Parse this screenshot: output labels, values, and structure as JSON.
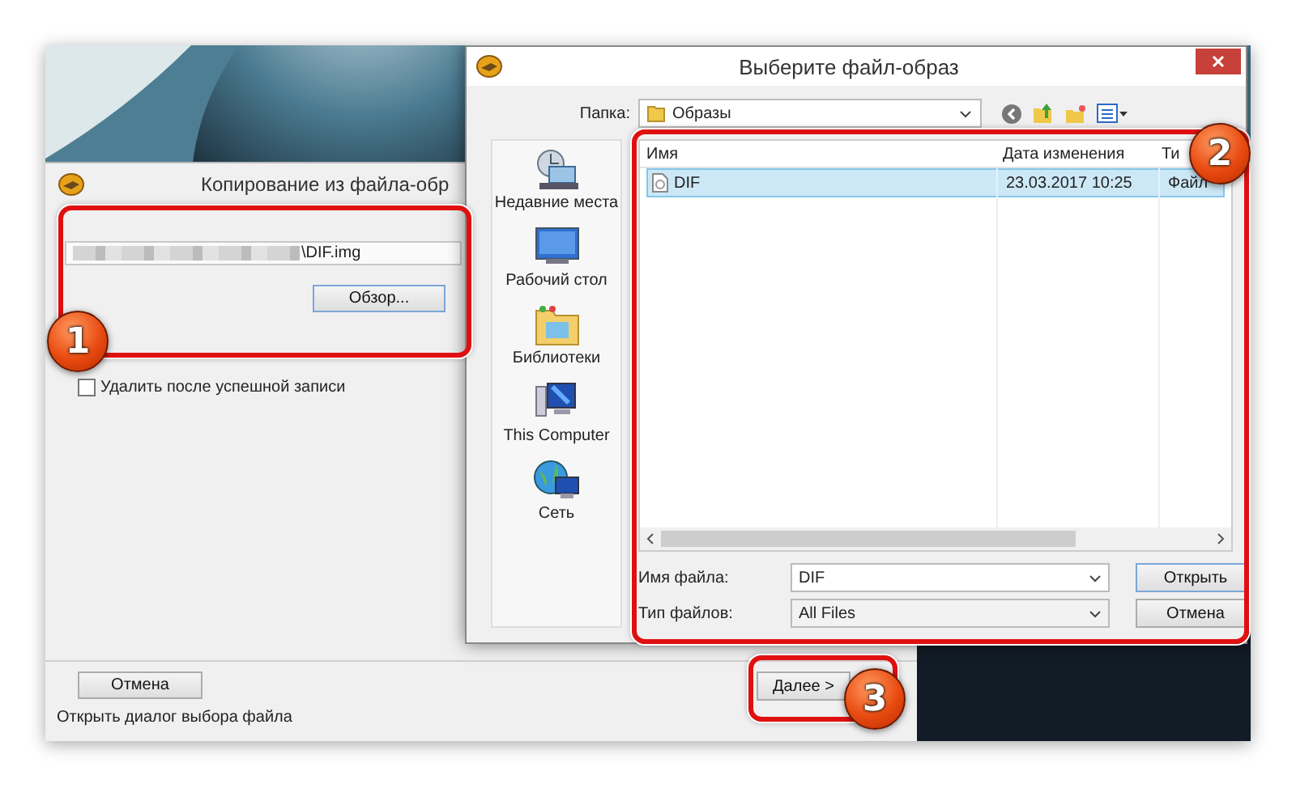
{
  "wizard": {
    "title": "Копирование из файла-обр",
    "path_field": {
      "value": "\\DIF.img"
    },
    "browse_button": "Обзор...",
    "delete_checkbox": {
      "label": "Удалить после успешной записи",
      "checked": false
    },
    "cancel_button": "Отмена",
    "next_button": "Далее >",
    "status_bar": "Открыть диалог выбора файла"
  },
  "file_dialog": {
    "title": "Выберите файл-образ",
    "folder_label": "Папка:",
    "folder": "Образы",
    "places": [
      {
        "label": "Недавние места",
        "kind": "recent"
      },
      {
        "label": "Рабочий стол",
        "kind": "desktop"
      },
      {
        "label": "Библиотеки",
        "kind": "libraries"
      },
      {
        "label": "This Computer",
        "kind": "computer"
      },
      {
        "label": "Сеть",
        "kind": "network"
      }
    ],
    "columns": [
      "Имя",
      "Дата изменения",
      "Ти"
    ],
    "rows": [
      {
        "name": "DIF",
        "modified": "23.03.2017 10:25",
        "type": "Файл",
        "selected": true
      }
    ],
    "file_name": {
      "label": "Имя файла:",
      "value": "DIF"
    },
    "file_type": {
      "label": "Тип файлов:",
      "value": "All Files"
    },
    "buttons": [
      "Открыть",
      "Отмена"
    ]
  },
  "annotations": [
    {
      "number": "1"
    },
    {
      "number": "2"
    },
    {
      "number": "3"
    }
  ]
}
